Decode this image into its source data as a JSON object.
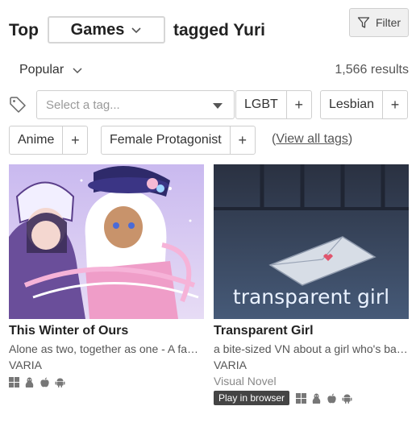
{
  "header": {
    "prefix": "Top",
    "type_selected": "Games",
    "suffix": "tagged Yuri",
    "filter_label": "Filter"
  },
  "sort": {
    "selected": "Popular",
    "results_count": "1,566 results"
  },
  "tags": {
    "select_placeholder": "Select a tag...",
    "chips": [
      {
        "label": "LGBT",
        "add": "+"
      },
      {
        "label": "Lesbian",
        "add": "+"
      },
      {
        "label": "Anime",
        "add": "+"
      },
      {
        "label": "Female Protagonist",
        "add": "+"
      }
    ],
    "view_all_open": "(",
    "view_all_label": "View all tags",
    "view_all_close": ")"
  },
  "games": [
    {
      "title": "This Winter of Ours",
      "description": "Alone as two, together as one - A fan-made visual novel",
      "author": "VARIA",
      "genre": "",
      "platforms": [
        "windows-icon",
        "linux-icon",
        "apple-icon",
        "android-icon"
      ]
    },
    {
      "title": "Transparent Girl",
      "description": "a bite-sized VN about a girl who's barely there",
      "author": "VARIA",
      "genre": "Visual Novel",
      "play_in_browser": "Play in browser",
      "thumb_text": "transparent girl",
      "platforms": [
        "windows-icon",
        "linux-icon",
        "apple-icon",
        "android-icon"
      ]
    }
  ],
  "colors": {
    "text_primary": "#222222",
    "text_secondary": "#555555",
    "border": "#cfcfcf",
    "badge_bg": "#444444"
  }
}
